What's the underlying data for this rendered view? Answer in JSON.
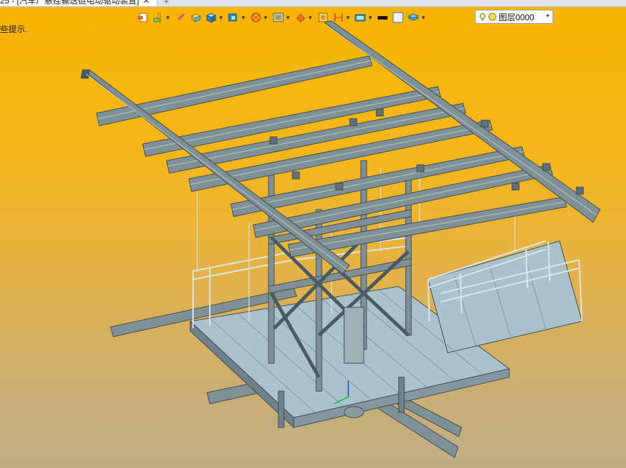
{
  "tab": {
    "title": "25 - [汽车厂悬挂输送链电动驱动装置]",
    "close": "✕",
    "add": "+"
  },
  "viewport": {
    "hint": "些提示."
  },
  "toolbar": {
    "icons": [
      "close-file-icon",
      "paint-brush-icon",
      "pencil-icon",
      "box-edit-icon",
      "cube-icon",
      "view-cube-icon",
      "section-icon",
      "frame-icon",
      "coordinate-icon",
      "fit-view-icon",
      "dimension-icon",
      "render-icon",
      "black-fill-icon",
      "white-fill-icon",
      "layer-stack-icon"
    ]
  },
  "layer": {
    "name": "图层0000",
    "arrow": "▾"
  },
  "colors": {
    "steel": "#7f9096",
    "steel_dark": "#3f4c52",
    "floor": "#a9c2cb",
    "rail": "#c7d8df"
  }
}
